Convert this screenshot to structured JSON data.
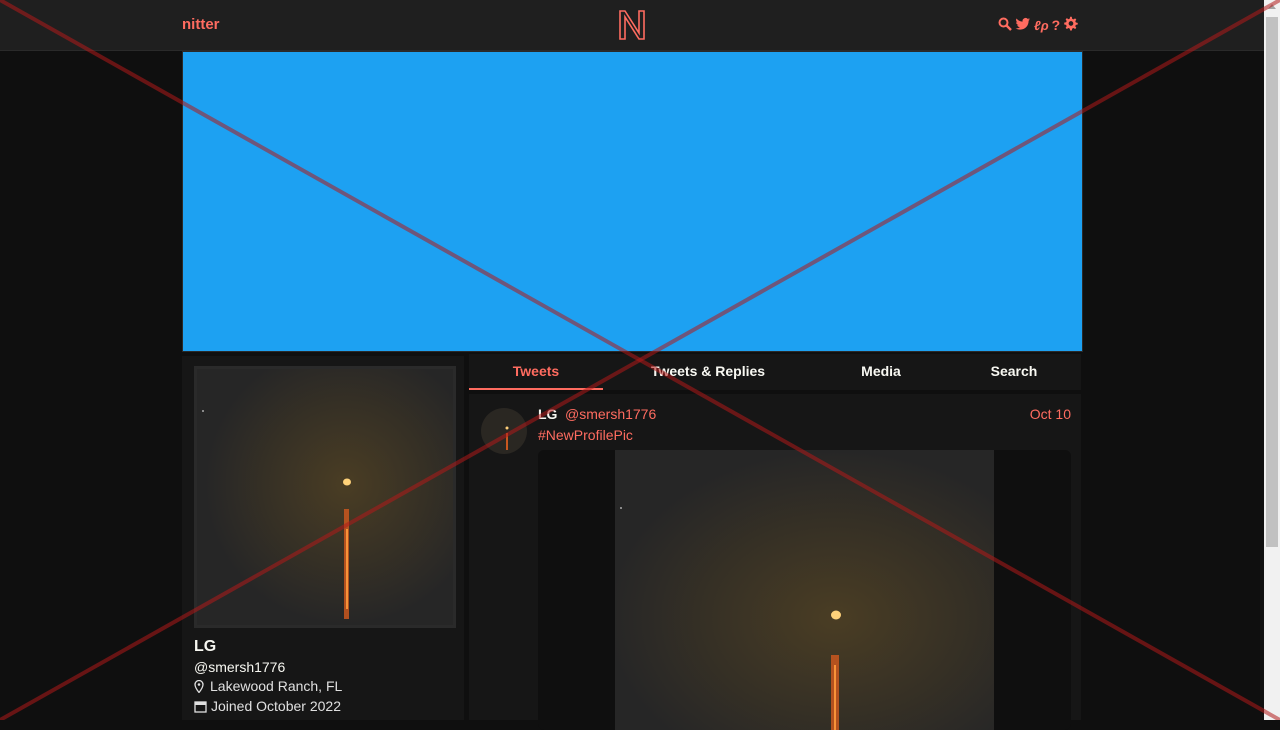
{
  "nav": {
    "brand": "nitter",
    "logo_letter": "N",
    "icons": [
      "search-icon",
      "twitter-bird-icon",
      "rss-icon",
      "help-icon",
      "gear-icon"
    ],
    "icon_glyphs": [
      "⌕",
      "🐦",
      "ℓρ",
      "?",
      "⚙"
    ]
  },
  "profile": {
    "fullname": "LG",
    "username": "@smersh1776",
    "location": "Lakewood Ranch, FL",
    "joined": "Joined October 2022"
  },
  "tabs": [
    {
      "label": "Tweets",
      "active": true
    },
    {
      "label": "Tweets & Replies",
      "active": false
    },
    {
      "label": "Media",
      "active": false
    },
    {
      "label": "Search",
      "active": false
    }
  ],
  "tweet": {
    "fullname": "LG",
    "username": "@smersh1776",
    "date": "Oct 10",
    "text": "#NewProfilePic"
  },
  "colors": {
    "accent": "#ff6c60",
    "banner": "#1da1f2",
    "background": "#0f0f0f",
    "panel": "#161616"
  }
}
